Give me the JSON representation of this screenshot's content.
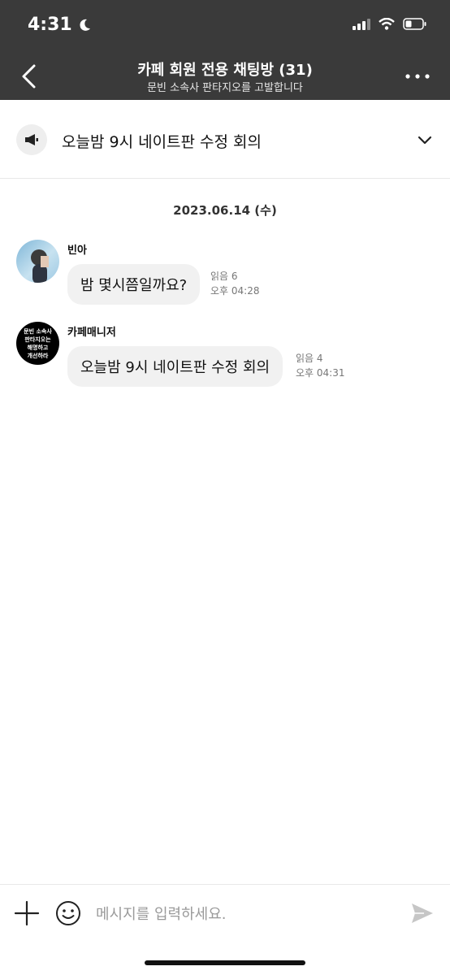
{
  "status_bar": {
    "time": "4:31"
  },
  "header": {
    "title": "카페 회원 전용 채팅방 (31)",
    "subtitle": "문빈 소속사 판타지오를 고발합니다"
  },
  "notice": {
    "text": "오늘밤 9시 네이트판 수정 회의"
  },
  "date_divider": "2023.06.14 (수)",
  "messages": [
    {
      "sender": "빈아",
      "text": "밤 몇시쯤일까요?",
      "read": "읽음 6",
      "time": "오후 04:28"
    },
    {
      "sender": "카페매니저",
      "text": "오늘밤 9시 네이트판 수정 회의",
      "read": "읽음 4",
      "time": "오후 04:31",
      "avatar_text": [
        "문빈 소속사",
        "판타지오는",
        "해명하고",
        "개선하라"
      ]
    }
  ],
  "composer": {
    "placeholder": "메시지를 입력하세요."
  }
}
